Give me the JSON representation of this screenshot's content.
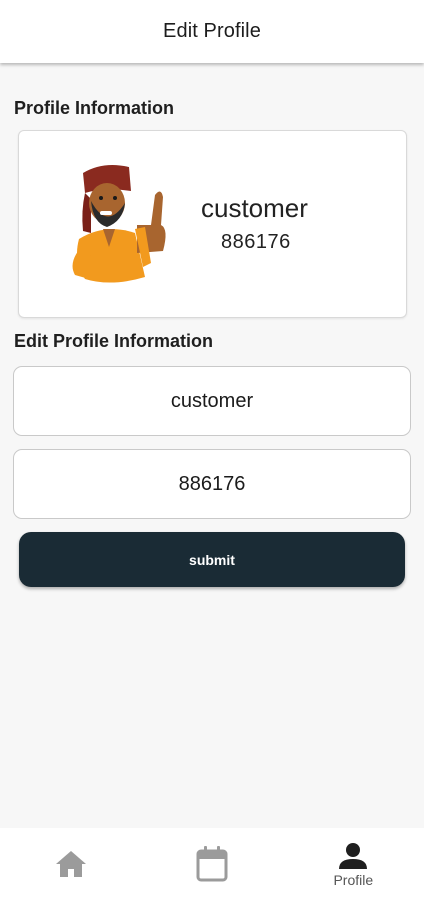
{
  "appbar": {
    "title": "Edit Profile"
  },
  "sections": {
    "profile_info": "Profile Information",
    "edit_info": "Edit Profile Information"
  },
  "profile": {
    "name": "customer",
    "id": "886176"
  },
  "form": {
    "name_value": "customer",
    "id_value": "886176"
  },
  "actions": {
    "submit_label": "submit"
  },
  "bottom_nav": {
    "items": [
      {
        "icon": "home-icon",
        "label": ""
      },
      {
        "icon": "calendar-icon",
        "label": ""
      },
      {
        "icon": "person-icon",
        "label": "Profile",
        "active": true
      }
    ]
  },
  "colors": {
    "primary_button": "#1a2b35",
    "background": "#f7f7f7",
    "icon_inactive": "#9b9b9b",
    "icon_active": "#1f1f1f"
  }
}
